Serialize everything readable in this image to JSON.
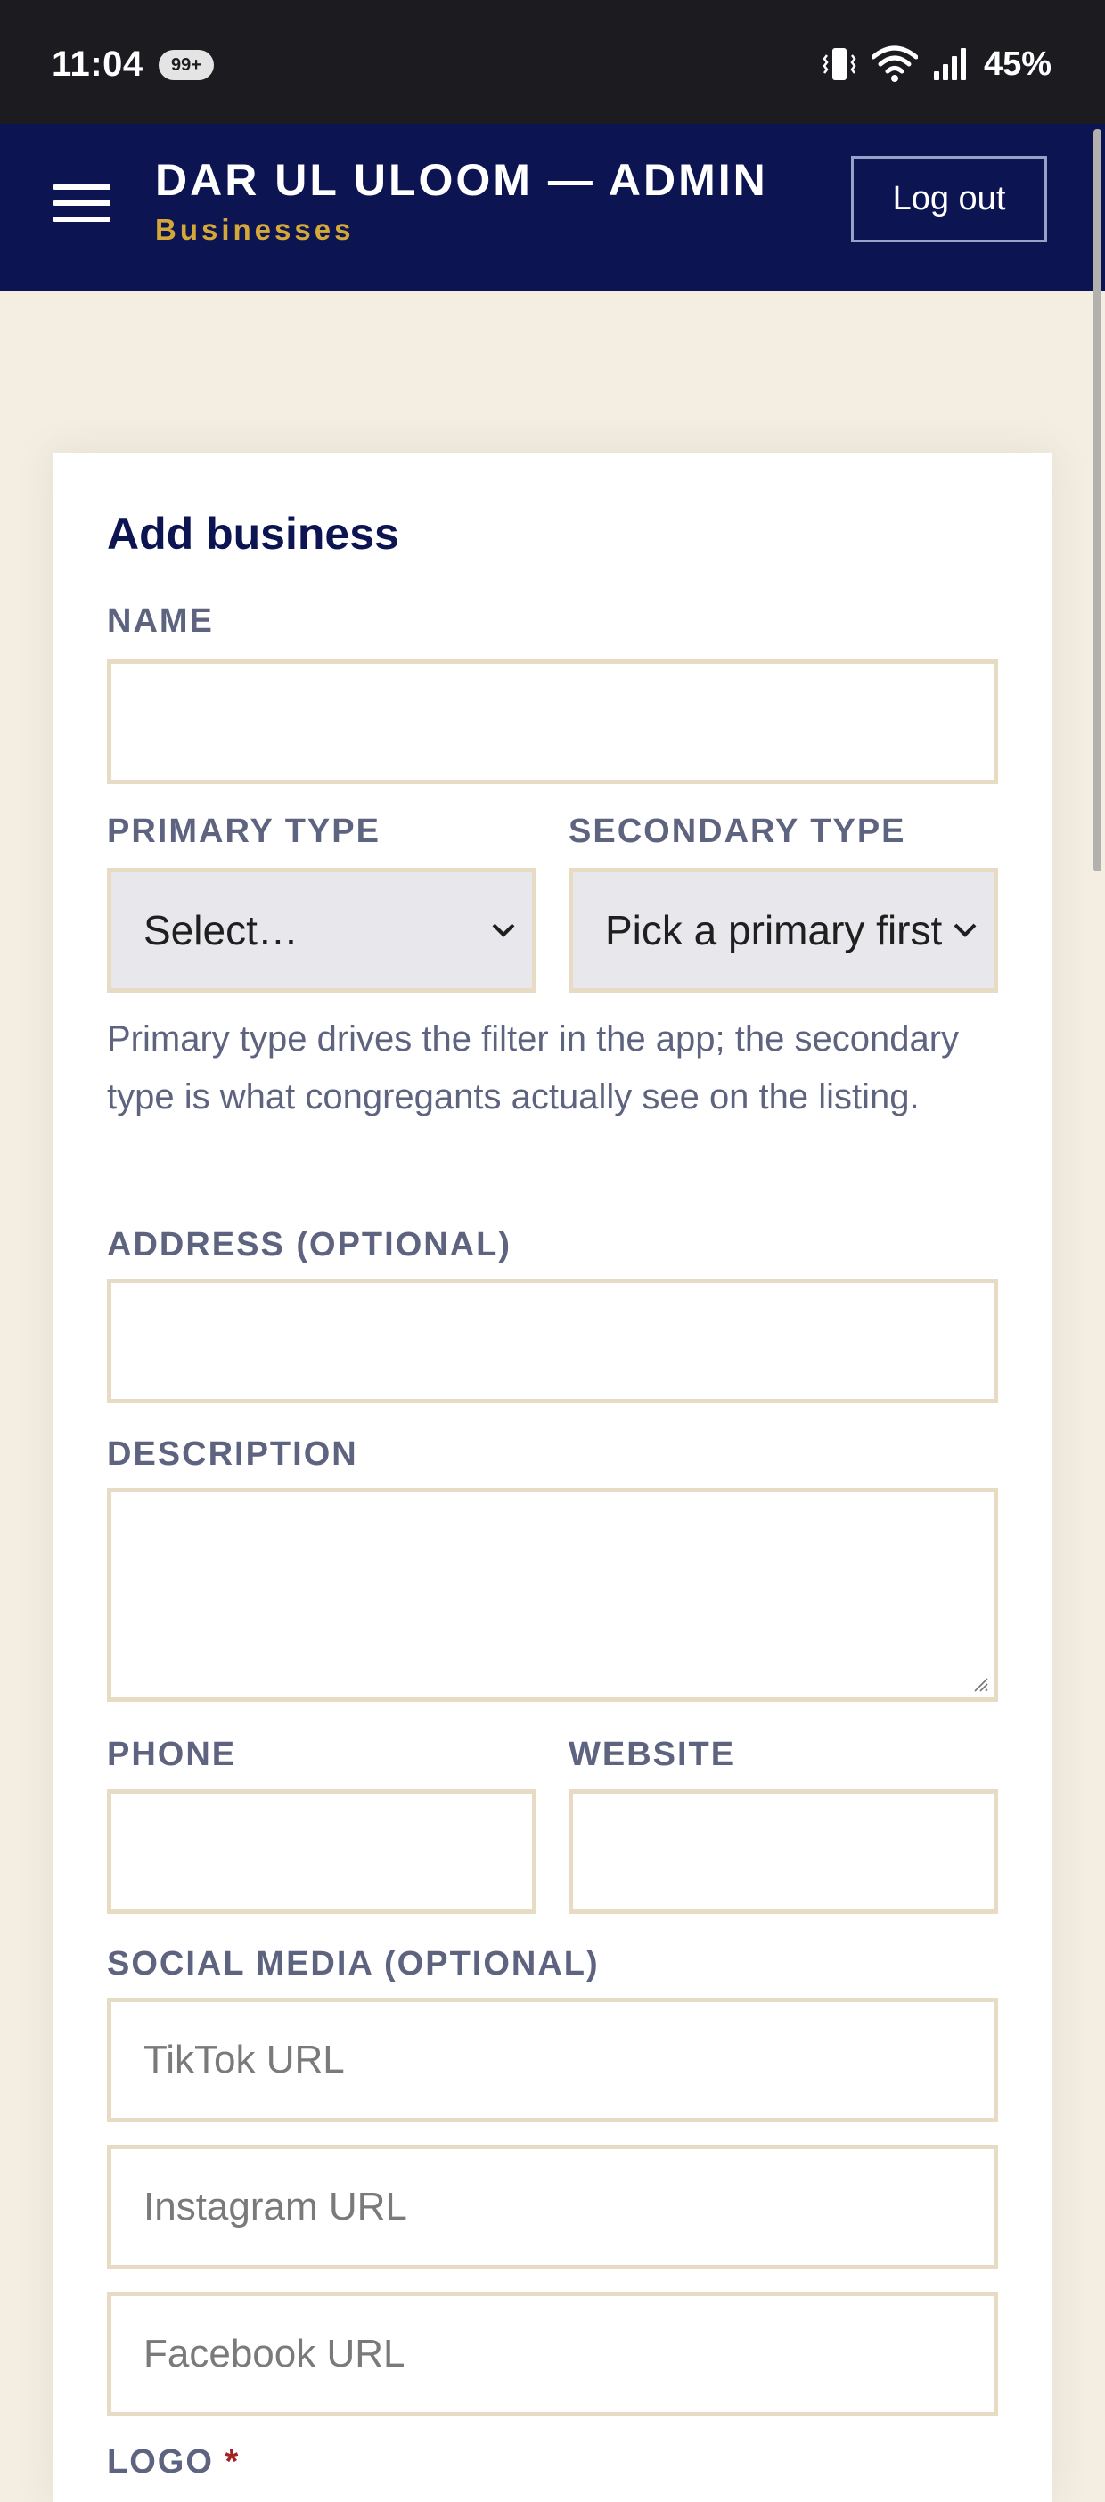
{
  "status_bar": {
    "time": "11:04",
    "notification_badge": "99+",
    "battery": "45%",
    "icons": [
      "vibrate-icon",
      "wifi-icon",
      "signal-icon"
    ]
  },
  "header": {
    "title": "DAR UL ULOOM — ADMIN",
    "subtitle": "Businesses",
    "logout_label": "Log out",
    "menu_icon": "hamburger-menu-icon",
    "colors": {
      "background": "#0c1451",
      "subtitle": "#d4a838"
    }
  },
  "form": {
    "title": "Add business",
    "name_label": "NAME",
    "name_value": "",
    "primary_type_label": "PRIMARY TYPE",
    "primary_type_value": "Select…",
    "secondary_type_label": "SECONDARY TYPE",
    "secondary_type_value": "Pick a primary first",
    "type_help": "Primary type drives the filter in the app; the secondary type is what congregants actually see on the listing.",
    "address_label": "ADDRESS (OPTIONAL)",
    "address_value": "",
    "description_label": "DESCRIPTION",
    "description_value": "",
    "phone_label": "PHONE",
    "phone_value": "",
    "website_label": "WEBSITE",
    "website_value": "",
    "social_label": "SOCIAL MEDIA (OPTIONAL)",
    "tiktok_placeholder": "TikTok URL",
    "instagram_placeholder": "Instagram URL",
    "facebook_placeholder": "Facebook URL",
    "logo_label": "LOGO",
    "required_mark": "*"
  }
}
